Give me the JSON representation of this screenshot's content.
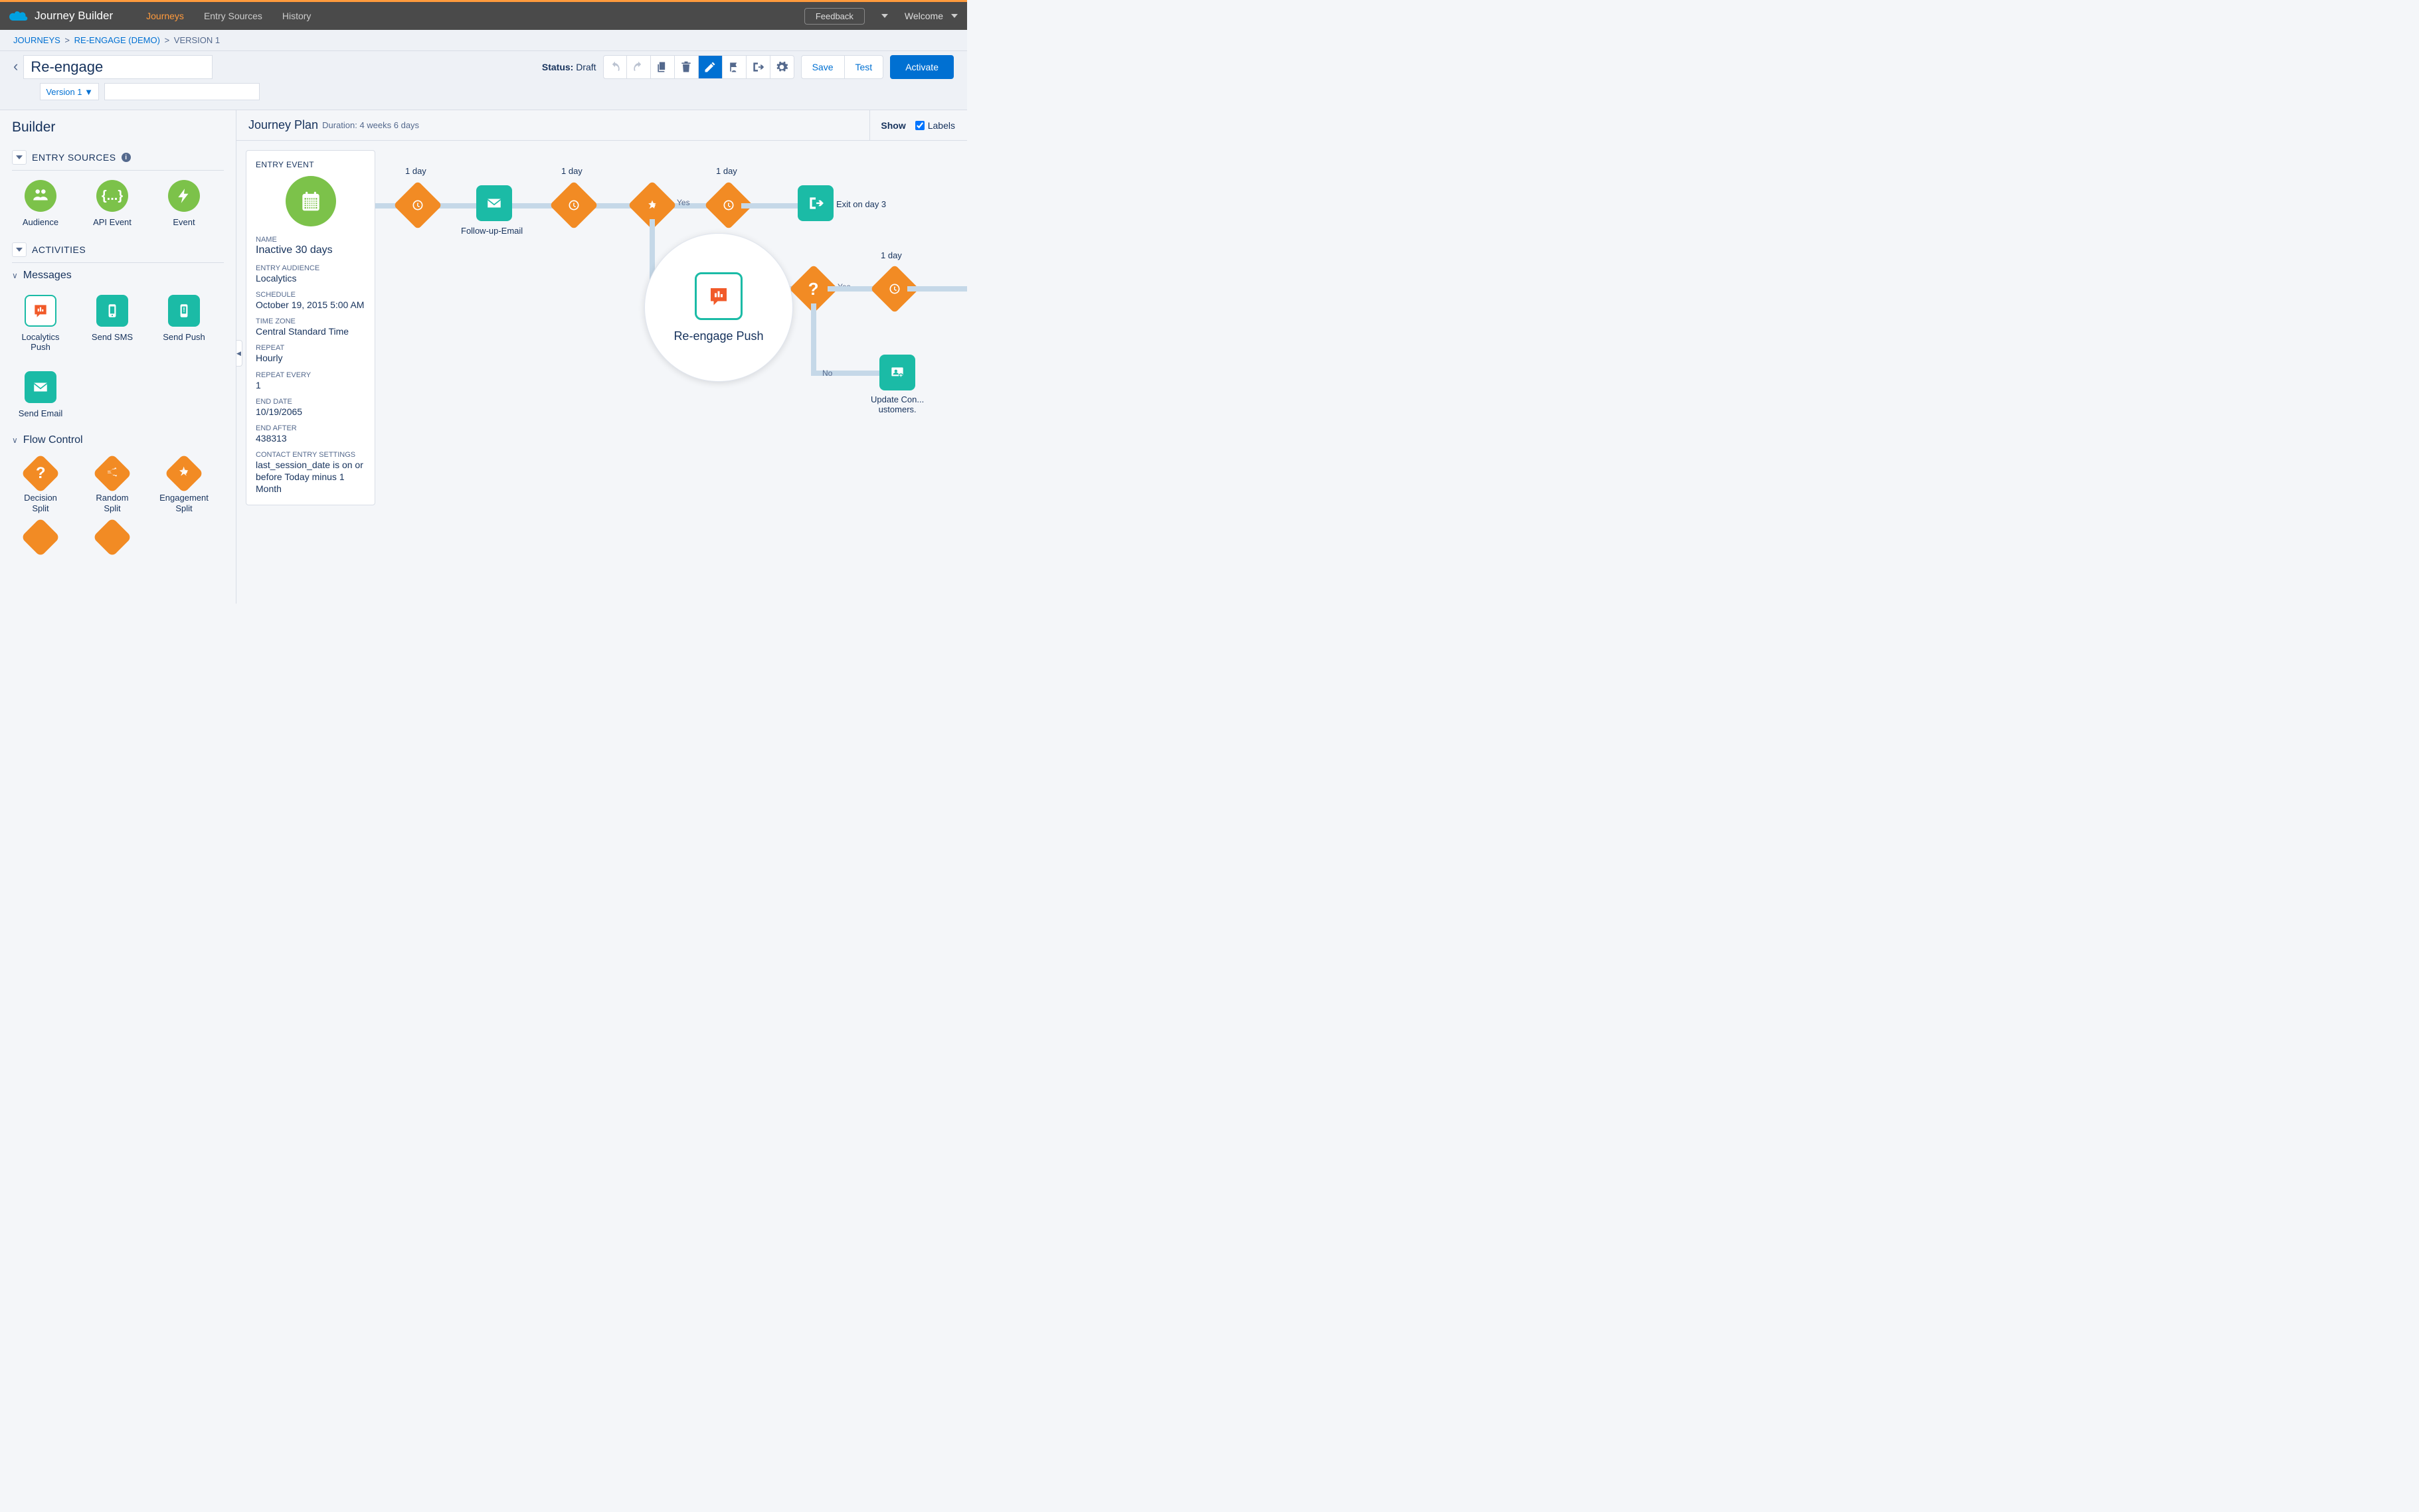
{
  "app_title": "Journey Builder",
  "topnav": {
    "journeys": "Journeys",
    "entry_sources": "Entry Sources",
    "history": "History"
  },
  "feedback": "Feedback",
  "welcome": "Welcome",
  "breadcrumb": {
    "root": "JOURNEYS",
    "mid": "RE-ENGAGE (DEMO)",
    "leaf": "VERSION 1"
  },
  "journey_name": "Re-engage",
  "version_dropdown": "Version 1 ▼",
  "status": {
    "label": "Status:",
    "value": "Draft"
  },
  "action_buttons": {
    "save": "Save",
    "test": "Test",
    "activate": "Activate"
  },
  "sidebar": {
    "title": "Builder",
    "entry_sources_label": "ENTRY SOURCES",
    "activities_label": "ACTIVITIES",
    "messages_label": "Messages",
    "flow_control_label": "Flow Control",
    "sources": {
      "audience": "Audience",
      "api_event": "API Event",
      "event": "Event"
    },
    "messages": {
      "localytics": "Localytics Push",
      "send_sms": "Send SMS",
      "send_push": "Send Push",
      "send_email": "Send Email"
    },
    "flow": {
      "decision": "Decision Split",
      "random": "Random Split",
      "engagement": "Engagement Split"
    }
  },
  "canvas_header": {
    "title": "Journey Plan",
    "duration_label": "Duration: 4 weeks 6 days",
    "show": "Show",
    "labels_chk": "Labels"
  },
  "entry_card": {
    "header": "ENTRY EVENT",
    "name_label": "NAME",
    "name": "Inactive 30 days",
    "audience_label": "ENTRY AUDIENCE",
    "audience": "Localytics",
    "schedule_label": "SCHEDULE",
    "schedule": "October 19, 2015 5:00 AM",
    "tz_label": "TIME ZONE",
    "tz": "Central Standard Time",
    "repeat_label": "REPEAT",
    "repeat": "Hourly",
    "repeat_every_label": "REPEAT EVERY",
    "repeat_every": "1",
    "end_date_label": "END DATE",
    "end_date": "10/19/2065",
    "end_after_label": "END AFTER",
    "end_after": "438313",
    "ces_label": "CONTACT ENTRY SETTINGS",
    "ces": "last_session_date is on or before Today minus 1 Month"
  },
  "nodes": {
    "wait1_top": "1 day",
    "wait2_top": "1 day",
    "wait3_top": "1 day",
    "wait4_top": "1 day",
    "followup": "Follow-up-Email",
    "exit": "Exit on day 3",
    "reengage_push": "Re-engage Push",
    "update_customers_l1": "Update Con...",
    "update_customers_l2": "ustomers.",
    "yes": "Yes",
    "no": "No"
  }
}
